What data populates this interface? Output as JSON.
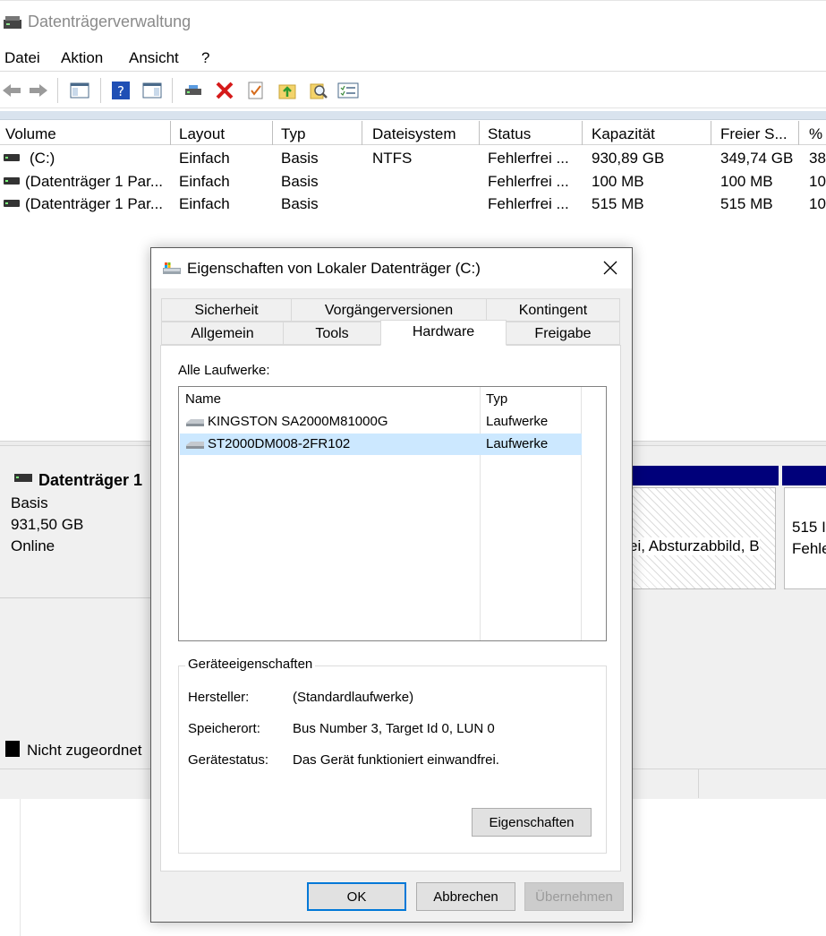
{
  "window": {
    "title": "Datenträgerverwaltung"
  },
  "menu": [
    "Datei",
    "Aktion",
    "Ansicht",
    "?"
  ],
  "toolbar_icons": [
    "back-arrow-icon",
    "forward-arrow-icon",
    "console-tree-icon",
    "help-icon",
    "action-pane-icon",
    "connect-icon",
    "delete-icon",
    "properties-check-icon",
    "up-folder-icon",
    "search-icon",
    "list-icon"
  ],
  "volumes": {
    "headers": [
      "Volume",
      "Layout",
      "Typ",
      "Dateisystem",
      "Status",
      "Kapazität",
      "Freier S...",
      "%"
    ],
    "rows": [
      {
        "volume": "(C:)",
        "layout": "Einfach",
        "typ": "Basis",
        "fs": "NTFS",
        "status": "Fehlerfrei ...",
        "cap": "930,89 GB",
        "free": "349,74 GB",
        "pct": "38"
      },
      {
        "volume": "(Datenträger 1 Par...",
        "layout": "Einfach",
        "typ": "Basis",
        "fs": "",
        "status": "Fehlerfrei ...",
        "cap": "100 MB",
        "free": "100 MB",
        "pct": "10"
      },
      {
        "volume": "(Datenträger 1 Par...",
        "layout": "Einfach",
        "typ": "Basis",
        "fs": "",
        "status": "Fehlerfrei ...",
        "cap": "515 MB",
        "free": "515 MB",
        "pct": "10"
      }
    ]
  },
  "disk": {
    "name": "Datenträger 1",
    "type": "Basis",
    "size": "931,50 GB",
    "state": "Online"
  },
  "partitions": {
    "p1_text": "ei, Absturzabbild, B",
    "p2_size": "515 I",
    "p2_status": "Fehle"
  },
  "legend": {
    "unassigned": "Nicht zugeordnet"
  },
  "colors": {
    "partition_header": "#00007a",
    "selection": "#cce8ff",
    "default_button_border": "#0078d7"
  },
  "dialog": {
    "title": "Eigenschaften von Lokaler Datenträger (C:)",
    "tabs_row1": [
      "Sicherheit",
      "Vorgängerversionen",
      "Kontingent"
    ],
    "tabs_row2": [
      "Allgemein",
      "Tools",
      "Hardware",
      "Freigabe"
    ],
    "active_tab": "Hardware",
    "all_drives_label": "Alle Laufwerke:",
    "list_headers": [
      "Name",
      "Typ"
    ],
    "drives": [
      {
        "name": "KINGSTON SA2000M81000G",
        "type": "Laufwerke",
        "selected": false
      },
      {
        "name": "ST2000DM008-2FR102",
        "type": "Laufwerke",
        "selected": true
      }
    ],
    "device_props": {
      "title": "Geräteeigenschaften",
      "manufacturer_label": "Hersteller:",
      "manufacturer": "(Standardlaufwerke)",
      "location_label": "Speicherort:",
      "location": "Bus Number 3, Target Id 0, LUN 0",
      "status_label": "Gerätestatus:",
      "status": "Das Gerät funktioniert einwandfrei.",
      "properties_button": "Eigenschaften"
    },
    "buttons": {
      "ok": "OK",
      "cancel": "Abbrechen",
      "apply": "Übernehmen"
    }
  }
}
